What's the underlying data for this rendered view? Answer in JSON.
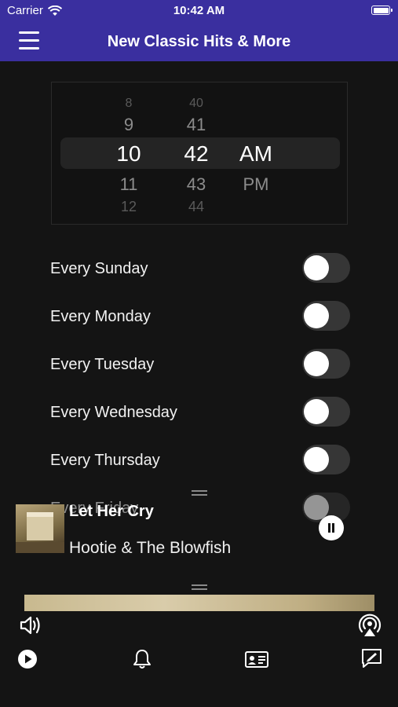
{
  "status_bar": {
    "carrier": "Carrier",
    "time": "10:42 AM"
  },
  "navbar": {
    "title": "New Classic Hits & More",
    "menu_icon": "hamburger-menu-icon"
  },
  "time_picker": {
    "hours": [
      "8",
      "9",
      "10",
      "11",
      "12"
    ],
    "minutes": [
      "40",
      "41",
      "42",
      "43",
      "44"
    ],
    "periods": [
      "AM",
      "PM"
    ],
    "selected": {
      "hour": "10",
      "minute": "42",
      "period": "AM"
    }
  },
  "alarm_days": [
    {
      "label": "Every Sunday",
      "on": false
    },
    {
      "label": "Every Monday",
      "on": false
    },
    {
      "label": "Every Tuesday",
      "on": false
    },
    {
      "label": "Every Wednesday",
      "on": false
    },
    {
      "label": "Every Thursday",
      "on": false
    },
    {
      "label": "Every Friday",
      "on": false
    }
  ],
  "now_playing": {
    "song": "Let Her Cry",
    "artist": "Hootie & The Blowfish",
    "state": "playing"
  },
  "bottom_controls": {
    "icons": [
      "speaker-icon",
      "airplay-icon"
    ],
    "tabs": [
      "play-tab-icon",
      "alarm-bell-icon",
      "contact-card-icon",
      "message-icon"
    ]
  }
}
